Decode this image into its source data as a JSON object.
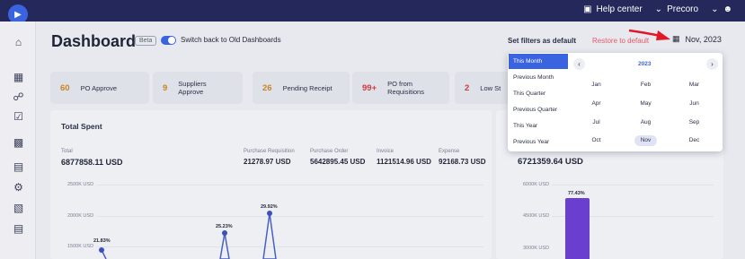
{
  "topbar": {
    "help_center": "Help center",
    "company": "Precoro"
  },
  "page": {
    "title": "Dashboard",
    "beta_badge": "Beta",
    "switch_label": "Switch back to Old Dashboards",
    "set_filters_default": "Set filters as default",
    "restore_default": "Restore to default",
    "date_filter": "Nov, 2023"
  },
  "cards": [
    {
      "count": "60",
      "label": "PO Approve"
    },
    {
      "count": "9",
      "label": "Suppliers Approve"
    },
    {
      "count": "26",
      "label": "Pending Receipt"
    },
    {
      "count": "99+",
      "label": "PO from Requisitions"
    },
    {
      "count": "2",
      "label": "Low St"
    }
  ],
  "total_spent": {
    "title": "Total Spent",
    "total_label": "Total",
    "total_value": "6877858.11 USD",
    "stats": [
      {
        "label": "Purchase Requisition",
        "value": "21278.97 USD"
      },
      {
        "label": "Purchase Order",
        "value": "5642895.45 USD"
      },
      {
        "label": "Invoice",
        "value": "1121514.96 USD"
      },
      {
        "label": "Expense",
        "value": "92168.73 USD"
      }
    ],
    "y_labels": [
      "2500K USD",
      "2000K USD",
      "1500K USD"
    ],
    "point_labels": [
      "21.83%",
      "25.23%",
      "29.92%"
    ]
  },
  "right_panel": {
    "value": "6721359.64 USD",
    "y_labels": [
      "6000K USD",
      "4500K USD",
      "3000K USD"
    ],
    "bar_label": "77.43%"
  },
  "date_picker": {
    "presets": [
      "This Month",
      "Previous Month",
      "This Quarter",
      "Previous Quarter",
      "This Year",
      "Previous Year"
    ],
    "selected_preset": "This Month",
    "year": "2023",
    "months": [
      "Jan",
      "Feb",
      "Mar",
      "Apr",
      "May",
      "Jun",
      "Jul",
      "Aug",
      "Sep",
      "Oct",
      "Nov",
      "Dec"
    ],
    "selected_month": "Nov"
  },
  "colors": {
    "topbar": "#24285a",
    "accent": "#3a63e0",
    "restore": "#e25a6a",
    "bar": "#6a3fd0",
    "arrow": "#e0182a"
  }
}
